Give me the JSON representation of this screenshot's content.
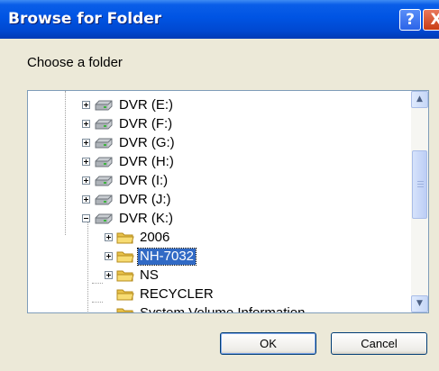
{
  "dialog": {
    "title": "Browse for Folder",
    "help_label": "?",
    "close_label": "X",
    "prompt": "Choose a folder"
  },
  "tree": {
    "items": [
      {
        "label": "DVR (E:)",
        "type": "drive",
        "expander": "plus"
      },
      {
        "label": "DVR (F:)",
        "type": "drive",
        "expander": "plus"
      },
      {
        "label": "DVR (G:)",
        "type": "drive",
        "expander": "plus"
      },
      {
        "label": "DVR (H:)",
        "type": "drive",
        "expander": "plus"
      },
      {
        "label": "DVR (I:)",
        "type": "drive",
        "expander": "plus"
      },
      {
        "label": "DVR (J:)",
        "type": "drive",
        "expander": "plus"
      },
      {
        "label": "DVR (K:)",
        "type": "drive",
        "expander": "minus"
      },
      {
        "label": "2006",
        "type": "folder",
        "expander": "plus"
      },
      {
        "label": "NH-7032",
        "type": "folder",
        "expander": "plus",
        "selected": true
      },
      {
        "label": "NS",
        "type": "folder",
        "expander": "plus"
      },
      {
        "label": "RECYCLER",
        "type": "folder",
        "expander": "none"
      },
      {
        "label": "System Volume Information",
        "type": "folder",
        "expander": "none"
      }
    ]
  },
  "buttons": {
    "ok_label": "OK",
    "cancel_label": "Cancel"
  },
  "colors": {
    "title_bar": "#0054e3",
    "selection": "#316ac5",
    "dialog_bg": "#ece9d8"
  },
  "icons": {
    "drive": "drive-icon",
    "folder": "folder-icon",
    "scroll_up": "scroll-up-arrow-icon",
    "scroll_down": "scroll-down-arrow-icon"
  }
}
